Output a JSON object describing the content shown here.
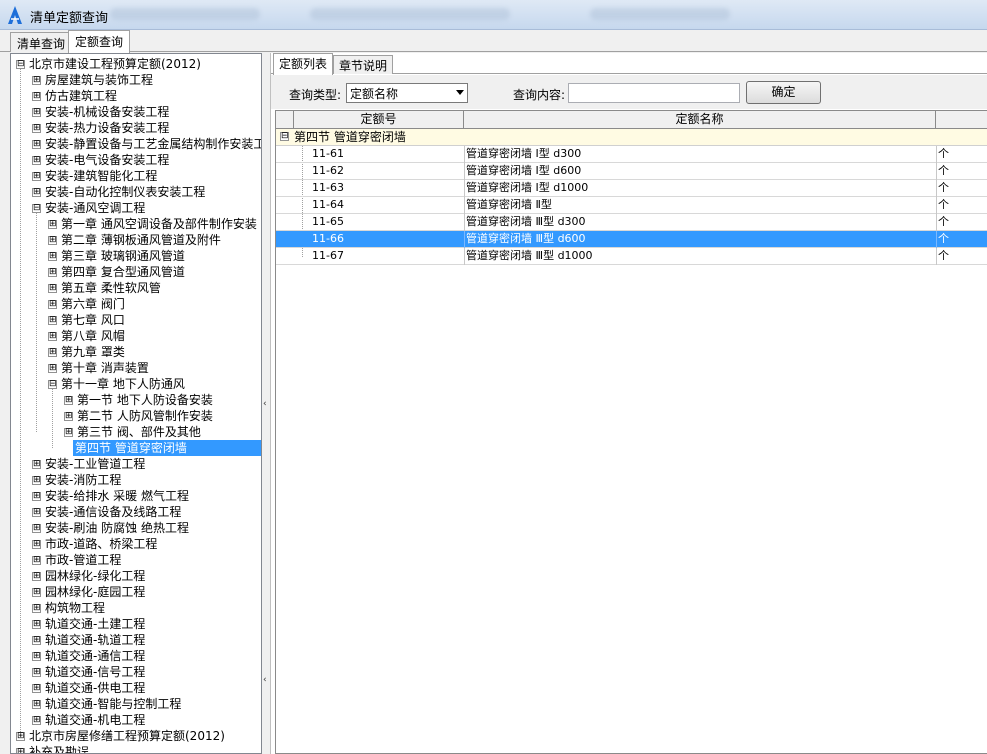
{
  "window": {
    "title": "清单定额查询"
  },
  "main_tabs": [
    {
      "label": "清单查询"
    },
    {
      "label": "定额查询"
    }
  ],
  "tree": {
    "items": [
      {
        "label": "北京市建设工程预算定额(2012)",
        "toggle": "⊟"
      },
      {
        "label": "房屋建筑与装饰工程",
        "toggle": "⊞"
      },
      {
        "label": "仿古建筑工程",
        "toggle": "⊞"
      },
      {
        "label": "安装-机械设备安装工程",
        "toggle": "⊞"
      },
      {
        "label": "安装-热力设备安装工程",
        "toggle": "⊞"
      },
      {
        "label": "安装-静置设备与工艺金属结构制作安装工",
        "toggle": "⊞"
      },
      {
        "label": "安装-电气设备安装工程",
        "toggle": "⊞"
      },
      {
        "label": "安装-建筑智能化工程",
        "toggle": "⊞"
      },
      {
        "label": "安装-自动化控制仪表安装工程",
        "toggle": "⊞"
      },
      {
        "label": "安装-通风空调工程",
        "toggle": "⊟"
      },
      {
        "label": "第一章 通风空调设备及部件制作安装",
        "toggle": "⊞"
      },
      {
        "label": "第二章 薄钢板通风管道及附件",
        "toggle": "⊞"
      },
      {
        "label": "第三章 玻璃钢通风管道",
        "toggle": "⊞"
      },
      {
        "label": "第四章 复合型通风管道",
        "toggle": "⊞"
      },
      {
        "label": "第五章 柔性软风管",
        "toggle": "⊞"
      },
      {
        "label": "第六章 阀门",
        "toggle": "⊞"
      },
      {
        "label": "第七章 风口",
        "toggle": "⊞"
      },
      {
        "label": "第八章 风帽",
        "toggle": "⊞"
      },
      {
        "label": "第九章 罩类",
        "toggle": "⊞"
      },
      {
        "label": "第十章 消声装置",
        "toggle": "⊞"
      },
      {
        "label": "第十一章 地下人防通风",
        "toggle": "⊟"
      },
      {
        "label": "第一节 地下人防设备安装",
        "toggle": "⊞"
      },
      {
        "label": "第二节 人防风管制作安装",
        "toggle": "⊞"
      },
      {
        "label": "第三节 阀、部件及其他",
        "toggle": "⊞"
      },
      {
        "label": "第四节 管道穿密闭墙",
        "toggle": ""
      },
      {
        "label": "安装-工业管道工程",
        "toggle": "⊞"
      },
      {
        "label": "安装-消防工程",
        "toggle": "⊞"
      },
      {
        "label": "安装-给排水 采暖 燃气工程",
        "toggle": "⊞"
      },
      {
        "label": "安装-通信设备及线路工程",
        "toggle": "⊞"
      },
      {
        "label": "安装-刷油 防腐蚀 绝热工程",
        "toggle": "⊞"
      },
      {
        "label": "市政-道路、桥梁工程",
        "toggle": "⊞"
      },
      {
        "label": "市政-管道工程",
        "toggle": "⊞"
      },
      {
        "label": "园林绿化-绿化工程",
        "toggle": "⊞"
      },
      {
        "label": "园林绿化-庭园工程",
        "toggle": "⊞"
      },
      {
        "label": "构筑物工程",
        "toggle": "⊞"
      },
      {
        "label": "轨道交通-土建工程",
        "toggle": "⊞"
      },
      {
        "label": "轨道交通-轨道工程",
        "toggle": "⊞"
      },
      {
        "label": "轨道交通-通信工程",
        "toggle": "⊞"
      },
      {
        "label": "轨道交通-信号工程",
        "toggle": "⊞"
      },
      {
        "label": "轨道交通-供电工程",
        "toggle": "⊞"
      },
      {
        "label": "轨道交通-智能与控制工程",
        "toggle": "⊞"
      },
      {
        "label": "轨道交通-机电工程",
        "toggle": "⊞"
      },
      {
        "label": "北京市房屋修缮工程预算定额(2012)",
        "toggle": "⊞"
      },
      {
        "label": "补充及勘误",
        "toggle": "⊞"
      }
    ]
  },
  "right_tabs": [
    {
      "label": "定额列表"
    },
    {
      "label": "章节说明"
    }
  ],
  "query": {
    "type_label": "查询类型:",
    "type_value": "定额名称",
    "content_label": "查询内容:",
    "content_value": "",
    "confirm_label": "确定"
  },
  "grid": {
    "columns": [
      "定额号",
      "定额名称",
      ""
    ],
    "group_label": "第四节 管道穿密闭墙",
    "group_toggle": "⊟",
    "rows": [
      {
        "code": "11-61",
        "name": "管道穿密闭墙 Ⅰ型 d300",
        "unit": "个"
      },
      {
        "code": "11-62",
        "name": "管道穿密闭墙 Ⅰ型 d600",
        "unit": "个"
      },
      {
        "code": "11-63",
        "name": "管道穿密闭墙 Ⅰ型 d1000",
        "unit": "个"
      },
      {
        "code": "11-64",
        "name": "管道穿密闭墙 Ⅱ型",
        "unit": "个"
      },
      {
        "code": "11-65",
        "name": "管道穿密闭墙 Ⅲ型 d300",
        "unit": "个"
      },
      {
        "code": "11-66",
        "name": "管道穿密闭墙 Ⅲ型 d600",
        "unit": "个"
      },
      {
        "code": "11-67",
        "name": "管道穿密闭墙 Ⅲ型 d1000",
        "unit": "个"
      }
    ]
  },
  "colors": {
    "selection": "#3399ff",
    "group_row": "#fffbe3"
  },
  "icons": {
    "app": "app-logo-icon",
    "splitter": "collapse-left-arrow-icon"
  }
}
